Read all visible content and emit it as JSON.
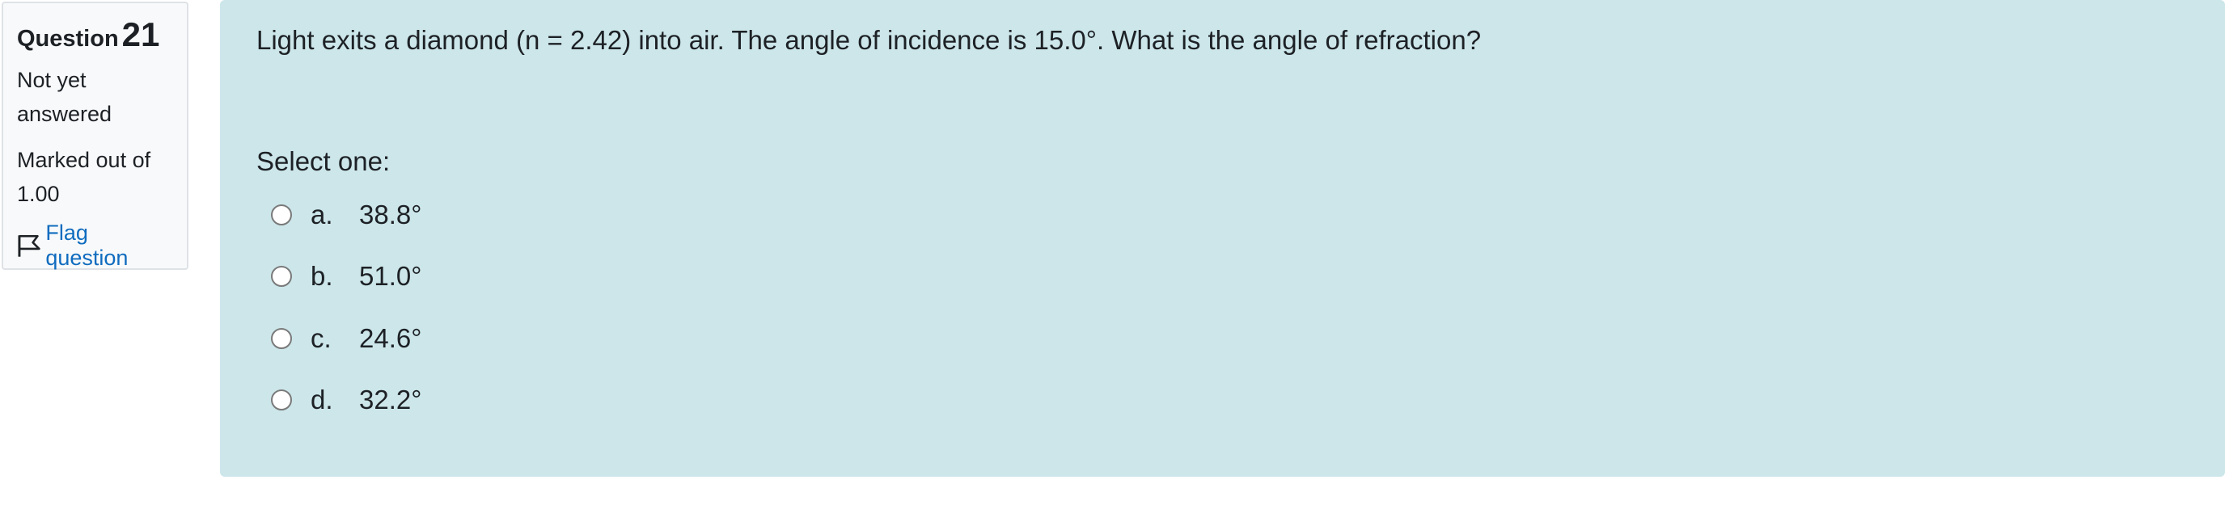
{
  "info": {
    "question_label": "Question",
    "question_number": "21",
    "state": "Not yet answered",
    "grade": "Marked out of 1.00",
    "flag_label": "Flag question"
  },
  "question": {
    "text": "Light exits a diamond (n = 2.42) into air. The angle of incidence is 15.0°. What is the angle of refraction?",
    "prompt": "Select one:",
    "options": [
      {
        "letter": "a.",
        "value": "38.8°"
      },
      {
        "letter": "b.",
        "value": "51.0°"
      },
      {
        "letter": "c.",
        "value": "24.6°"
      },
      {
        "letter": "d.",
        "value": "32.2°"
      }
    ]
  },
  "icons": {
    "flag": "flag-icon"
  },
  "colors": {
    "content_bg": "#cce6ea",
    "info_bg": "#f8f9fa",
    "link": "#0f6cbf",
    "text": "#1d2125"
  }
}
